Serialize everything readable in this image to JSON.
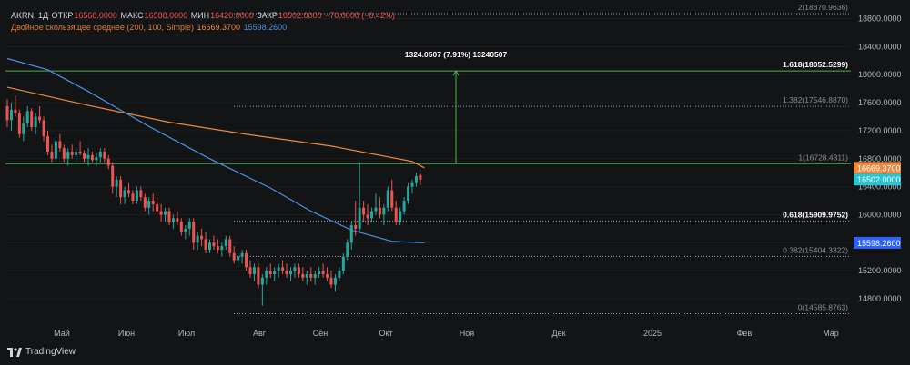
{
  "legend": {
    "symbol": "AKRN, 1Д",
    "open_label": "ОТКР",
    "open": "16568.0000",
    "high_label": "МАКС",
    "high": "16588.0000",
    "low_label": "МИН",
    "low": "16420.0000",
    "close_label": "ЗАКР",
    "close": "16502.0000",
    "change": "−70.0000 (−0.42%)",
    "ma_name": "Двойное скользящее среднее (200, 100, Simple)",
    "ma_fast": "16669.3700",
    "ma_slow": "15598.2600"
  },
  "footer": {
    "brand": "TradingView"
  },
  "colors": {
    "background": "#131416",
    "up": "#26a69a",
    "down": "#ef5350",
    "ma200": "#f0883e",
    "ma100": "#4a90e2",
    "fib_lines": "#9598a1",
    "fib_green": "#4caf50",
    "axis_text": "#b2b5be"
  },
  "chart_data": {
    "type": "candlestick",
    "y_axis": {
      "ticks": [
        "18800.0000",
        "18400.0000",
        "18000.0000",
        "17600.0000",
        "17200.0000",
        "16800.0000",
        "16400.0000",
        "16000.0000",
        "15600.0000",
        "15200.0000",
        "14800.0000"
      ],
      "tick_values": [
        18800,
        18400,
        18000,
        17600,
        17200,
        16800,
        16400,
        16000,
        15600,
        15200,
        14800
      ],
      "range": [
        14650,
        19000
      ],
      "price_badges": [
        {
          "value": 16669.37,
          "text": "16669.3700",
          "color": "#f0883e"
        },
        {
          "value": 16502.0,
          "text": "16502.0000",
          "color": "#26c6da"
        },
        {
          "value": 15598.26,
          "text": "15598.2600",
          "color": "#2962ff"
        }
      ]
    },
    "x_axis": {
      "labels": [
        "Май",
        "Июн",
        "Июл",
        "Авг",
        "Сен",
        "Окт",
        "Ноя",
        "Дек",
        "2025",
        "Фев",
        "Мар"
      ]
    },
    "fibonacci": [
      {
        "level": "2",
        "value": 18870.9636,
        "text": "2(18870.9636)",
        "style": "dotted"
      },
      {
        "level": "1.618",
        "value": 18052.5299,
        "text": "1.618(18052.5299)",
        "style": "solid-green"
      },
      {
        "level": "1.382",
        "value": 17546.887,
        "text": "1.382(17546.8870)",
        "style": "dotted"
      },
      {
        "level": "1",
        "value": 16728.4311,
        "text": "1(16728.4311)",
        "style": "solid-green"
      },
      {
        "level": "0.618",
        "value": 15909.9752,
        "text": "0.618(15909.9752)",
        "style": "dotted"
      },
      {
        "level": "0.382",
        "value": 15404.3322,
        "text": "0.382(15404.3322)",
        "style": "dotted"
      },
      {
        "level": "0",
        "value": 14585.8763,
        "text": "0(14585.8763)",
        "style": "dotted"
      }
    ],
    "measure": {
      "text": "1324.0507 (7.91%) 13240507",
      "from": 16728.4311,
      "to": 18052.5299
    },
    "candles": [
      [
        17550,
        17650,
        17250,
        17350
      ],
      [
        17350,
        17600,
        17200,
        17500
      ],
      [
        17500,
        17700,
        17400,
        17450
      ],
      [
        17450,
        17500,
        17100,
        17150
      ],
      [
        17150,
        17400,
        17050,
        17300
      ],
      [
        17300,
        17550,
        17250,
        17480
      ],
      [
        17480,
        17520,
        17200,
        17250
      ],
      [
        17250,
        17450,
        17150,
        17400
      ],
      [
        17400,
        17550,
        17300,
        17350
      ],
      [
        17350,
        17400,
        17050,
        17120
      ],
      [
        17120,
        17200,
        16850,
        16900
      ],
      [
        16900,
        17000,
        16750,
        16800
      ],
      [
        16800,
        17100,
        16780,
        17050
      ],
      [
        17050,
        17150,
        16900,
        16950
      ],
      [
        16950,
        17000,
        16750,
        16800
      ],
      [
        16800,
        16950,
        16700,
        16900
      ],
      [
        16900,
        17000,
        16800,
        16850
      ],
      [
        16850,
        16950,
        16780,
        16900
      ],
      [
        16900,
        17050,
        16850,
        16880
      ],
      [
        16880,
        16920,
        16750,
        16800
      ],
      [
        16800,
        16950,
        16700,
        16850
      ],
      [
        16850,
        16900,
        16750,
        16780
      ],
      [
        16780,
        16880,
        16700,
        16820
      ],
      [
        16820,
        16950,
        16750,
        16900
      ],
      [
        16900,
        16950,
        16750,
        16800
      ],
      [
        16800,
        16850,
        16650,
        16700
      ],
      [
        16700,
        16750,
        16300,
        16400
      ],
      [
        16400,
        16550,
        16250,
        16500
      ],
      [
        16500,
        16550,
        16150,
        16250
      ],
      [
        16250,
        16400,
        16150,
        16350
      ],
      [
        16350,
        16450,
        16250,
        16300
      ],
      [
        16300,
        16350,
        16150,
        16200
      ],
      [
        16200,
        16400,
        16150,
        16350
      ],
      [
        16350,
        16400,
        16200,
        16250
      ],
      [
        16250,
        16300,
        16050,
        16100
      ],
      [
        16100,
        16250,
        16000,
        16200
      ],
      [
        16200,
        16300,
        16050,
        16150
      ],
      [
        16150,
        16250,
        16000,
        16050
      ],
      [
        16050,
        16150,
        15900,
        16000
      ],
      [
        16000,
        16100,
        15900,
        16050
      ],
      [
        16050,
        16100,
        15850,
        15900
      ],
      [
        15900,
        16000,
        15800,
        15950
      ],
      [
        15950,
        16050,
        15850,
        15900
      ],
      [
        15900,
        15950,
        15700,
        15750
      ],
      [
        15750,
        15850,
        15650,
        15800
      ],
      [
        15800,
        15950,
        15700,
        15900
      ],
      [
        15900,
        15950,
        15500,
        15600
      ],
      [
        15600,
        15750,
        15500,
        15700
      ],
      [
        15700,
        15800,
        15550,
        15650
      ],
      [
        15650,
        15750,
        15450,
        15500
      ],
      [
        15500,
        15650,
        15450,
        15600
      ],
      [
        15600,
        15700,
        15500,
        15550
      ],
      [
        15550,
        15650,
        15450,
        15500
      ],
      [
        15500,
        15600,
        15400,
        15550
      ],
      [
        15550,
        15700,
        15500,
        15650
      ],
      [
        15650,
        15700,
        15400,
        15450
      ],
      [
        15450,
        15550,
        15300,
        15350
      ],
      [
        15350,
        15450,
        15250,
        15400
      ],
      [
        15400,
        15500,
        15300,
        15450
      ],
      [
        15450,
        15500,
        15200,
        15250
      ],
      [
        15250,
        15350,
        15100,
        15150
      ],
      [
        15150,
        15300,
        15050,
        15250
      ],
      [
        15250,
        15300,
        14950,
        15000
      ],
      [
        15000,
        15150,
        14700,
        15100
      ],
      [
        15100,
        15250,
        15000,
        15200
      ],
      [
        15200,
        15300,
        15100,
        15150
      ],
      [
        15150,
        15250,
        15050,
        15200
      ],
      [
        15200,
        15300,
        15100,
        15250
      ],
      [
        15250,
        15350,
        15150,
        15200
      ],
      [
        15200,
        15300,
        15100,
        15150
      ],
      [
        15150,
        15250,
        15050,
        15200
      ],
      [
        15200,
        15300,
        15100,
        15250
      ],
      [
        15250,
        15300,
        15100,
        15150
      ],
      [
        15150,
        15250,
        15050,
        15100
      ],
      [
        15100,
        15200,
        15000,
        15150
      ],
      [
        15150,
        15250,
        15050,
        15100
      ],
      [
        15100,
        15200,
        15000,
        15150
      ],
      [
        15150,
        15250,
        15100,
        15200
      ],
      [
        15200,
        15300,
        15100,
        15150
      ],
      [
        15150,
        15250,
        15050,
        15100
      ],
      [
        15100,
        15200,
        14950,
        15000
      ],
      [
        15000,
        15150,
        14900,
        15100
      ],
      [
        15100,
        15250,
        15050,
        15200
      ],
      [
        15200,
        15450,
        15150,
        15400
      ],
      [
        15400,
        15650,
        15350,
        15600
      ],
      [
        15600,
        15900,
        15500,
        15850
      ],
      [
        15850,
        16200,
        15700,
        15800
      ],
      [
        15800,
        16750,
        15750,
        16100
      ],
      [
        16100,
        16200,
        15900,
        16000
      ],
      [
        16000,
        16150,
        15850,
        15950
      ],
      [
        15950,
        16100,
        15900,
        16050
      ],
      [
        16050,
        16300,
        16000,
        16100
      ],
      [
        16100,
        16250,
        15950,
        16000
      ],
      [
        16000,
        16150,
        15850,
        16100
      ],
      [
        16100,
        16400,
        16050,
        16350
      ],
      [
        16350,
        16500,
        16050,
        16100
      ],
      [
        16100,
        16200,
        15850,
        15900
      ],
      [
        15900,
        16100,
        15850,
        16050
      ],
      [
        16050,
        16250,
        16000,
        16200
      ],
      [
        16200,
        16450,
        16150,
        16400
      ],
      [
        16400,
        16500,
        16300,
        16450
      ],
      [
        16450,
        16600,
        16400,
        16550
      ],
      [
        16568,
        16588,
        16420,
        16502
      ]
    ]
  }
}
